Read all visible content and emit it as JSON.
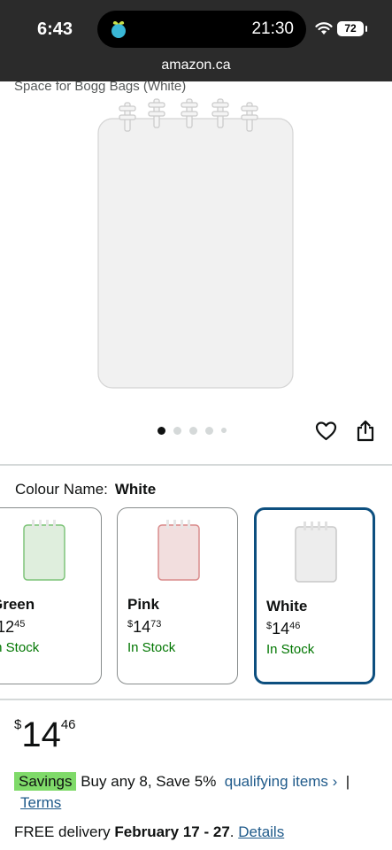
{
  "status_bar": {
    "time": "6:43",
    "island_time": "21:30",
    "battery": "72",
    "url": "amazon.ca"
  },
  "product": {
    "subtitle_fragment": "Space for Bogg Bags (White)",
    "image_dots": {
      "count": 5,
      "active_index": 0
    }
  },
  "variants": {
    "label": "Colour Name:",
    "selected_value": "White",
    "cards": [
      {
        "name": "Green",
        "symbol": "$",
        "whole": "12",
        "fraction": "45",
        "stock": "In Stock",
        "color": "#7fc47a",
        "selected": false
      },
      {
        "name": "Pink",
        "symbol": "$",
        "whole": "14",
        "fraction": "73",
        "stock": "In Stock",
        "color": "#d98c8c",
        "selected": false
      },
      {
        "name": "White",
        "symbol": "$",
        "whole": "14",
        "fraction": "46",
        "stock": "In Stock",
        "color": "#c8c8c8",
        "selected": true
      }
    ]
  },
  "price": {
    "symbol": "$",
    "whole": "14",
    "fraction": "46"
  },
  "promo": {
    "badge": "Savings",
    "text": "Buy any 8, Save 5%",
    "link": "qualifying items",
    "chevron": "›",
    "separator": "|",
    "terms": "Terms"
  },
  "delivery": {
    "prefix": "FREE delivery",
    "dates": "February 17 - 27",
    "punct": ".",
    "details_link": "Details"
  },
  "colors": {
    "accent_link": "#1f5a8a",
    "in_stock": "#007600",
    "selected_border": "#0d4f7f",
    "savings_badge": "#7fda69"
  },
  "icons": [
    "app-icon",
    "wifi-icon",
    "heart-icon",
    "share-icon",
    "chevron-right-icon"
  ]
}
